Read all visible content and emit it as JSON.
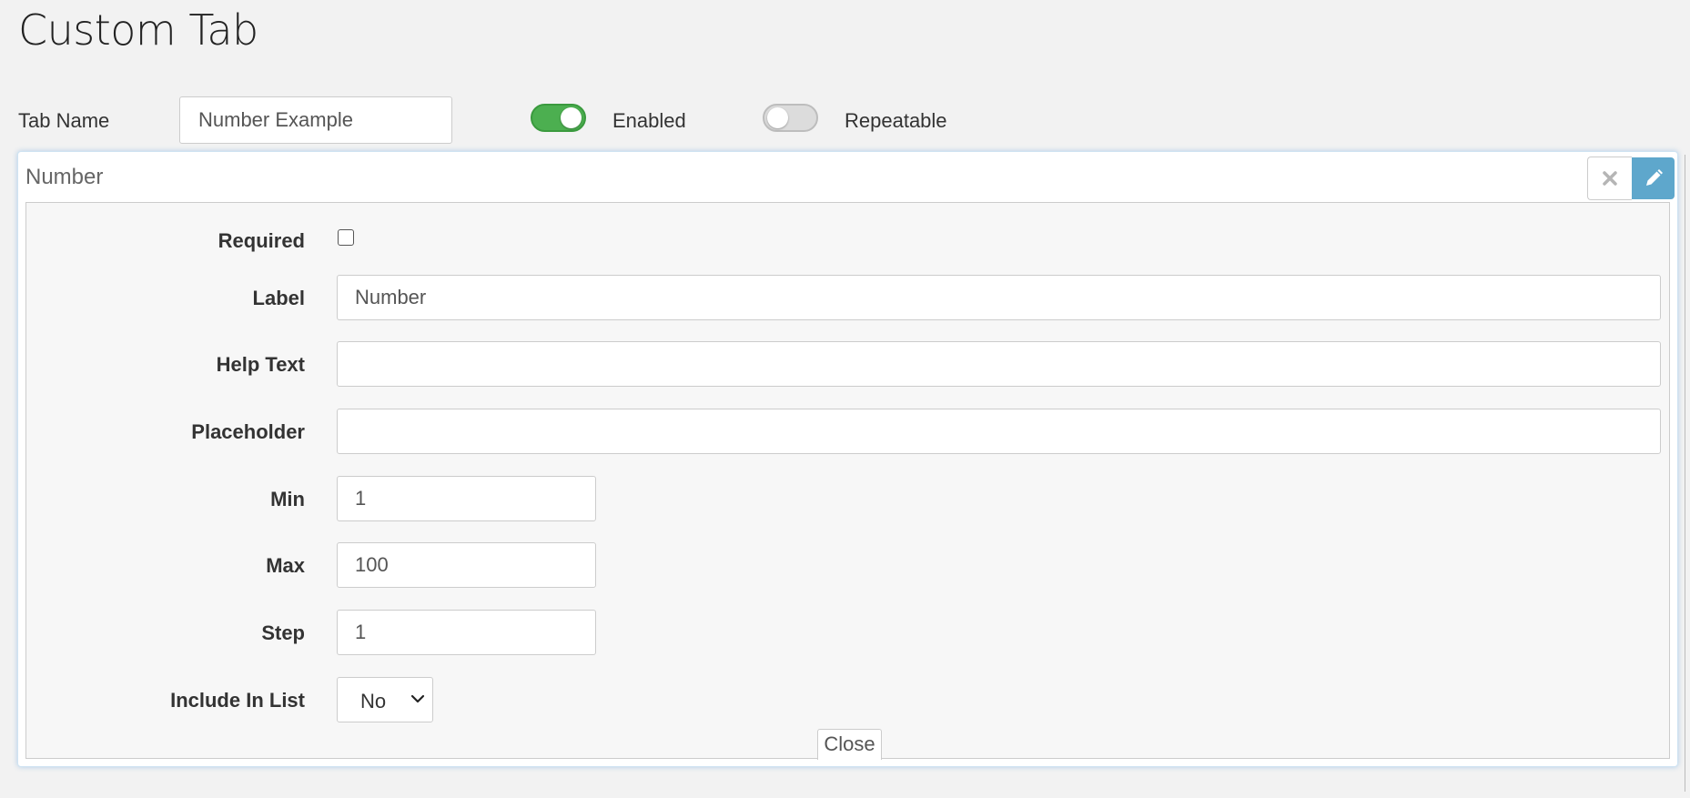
{
  "page": {
    "title": "Custom Tab"
  },
  "tab_settings": {
    "name_label": "Tab Name",
    "name_value": "Number Example",
    "enabled_label": "Enabled",
    "enabled": true,
    "repeatable_label": "Repeatable",
    "repeatable": false
  },
  "field_card": {
    "title": "Number",
    "icons": {
      "remove": "close-icon",
      "edit": "pencil-icon"
    },
    "form": {
      "required_label": "Required",
      "required_checked": false,
      "label_label": "Label",
      "label_value": "Number",
      "help_label": "Help Text",
      "help_value": "",
      "placeholder_label": "Placeholder",
      "placeholder_value": "",
      "min_label": "Min",
      "min_value": "1",
      "max_label": "Max",
      "max_value": "100",
      "step_label": "Step",
      "step_value": "1",
      "include_label": "Include In List",
      "include_value": "No"
    },
    "close_label": "Close"
  },
  "colors": {
    "toggle_on": "#4caf50",
    "toggle_off": "#dcdcdc",
    "edit_button": "#5ea7cc",
    "card_glow": "#cfe3f2"
  }
}
